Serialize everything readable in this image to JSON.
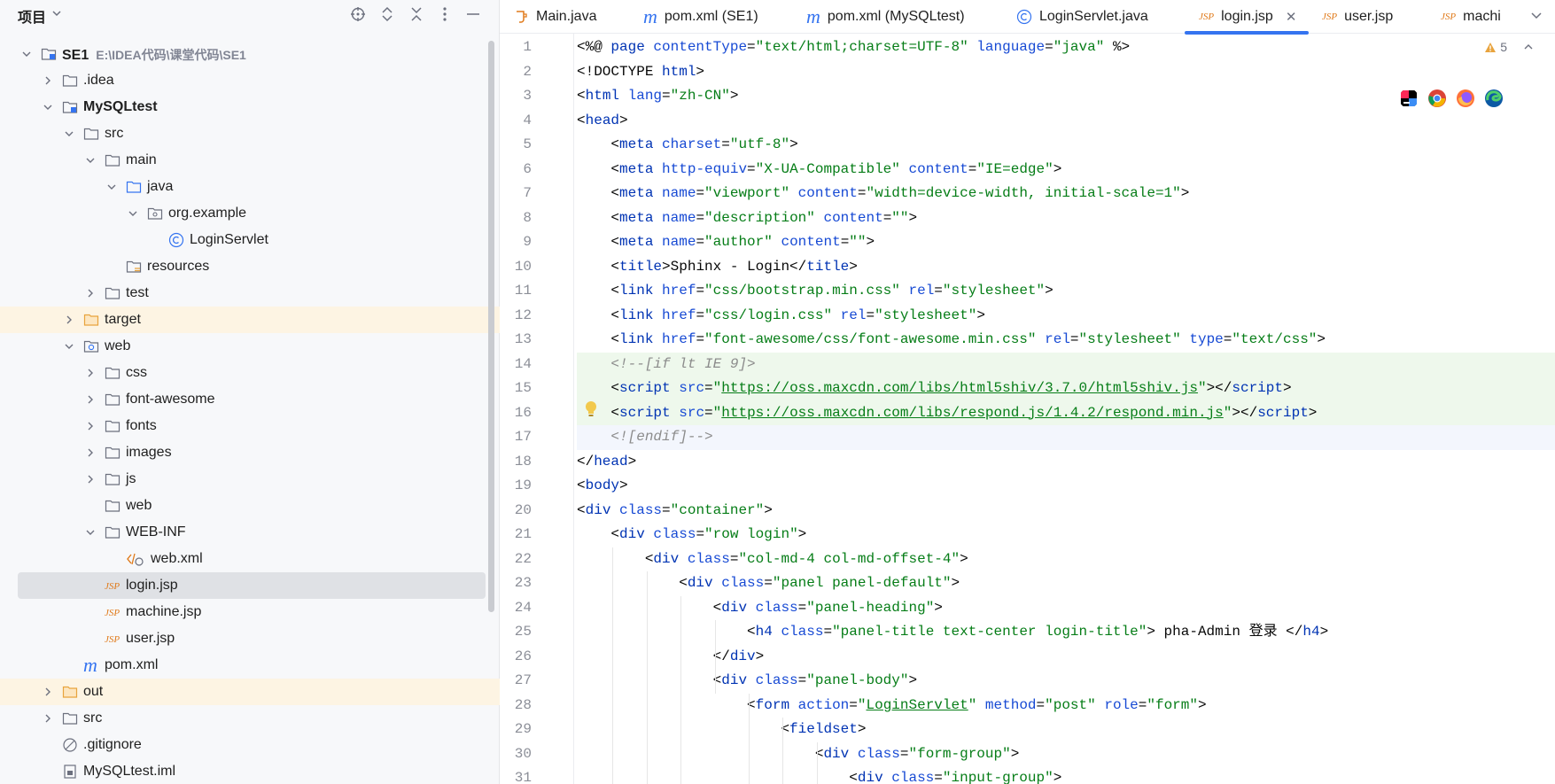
{
  "project_panel": {
    "title": "项目",
    "tree": [
      {
        "label": "SE1",
        "path": "E:\\IDEA代码\\课堂代码\\SE1",
        "depth": 0,
        "expanded": true,
        "icon": "module-folder-icon",
        "bold": true
      },
      {
        "label": ".idea",
        "depth": 1,
        "expanded": false,
        "icon": "folder-icon"
      },
      {
        "label": "MySQLtest",
        "depth": 1,
        "expanded": true,
        "icon": "module-folder-icon",
        "bold": true
      },
      {
        "label": "src",
        "depth": 2,
        "expanded": true,
        "icon": "folder-icon"
      },
      {
        "label": "main",
        "depth": 3,
        "expanded": true,
        "icon": "folder-icon"
      },
      {
        "label": "java",
        "depth": 4,
        "expanded": true,
        "icon": "source-folder-icon"
      },
      {
        "label": "org.example",
        "depth": 5,
        "expanded": true,
        "icon": "package-icon"
      },
      {
        "label": "LoginServlet",
        "depth": 6,
        "icon": "class-icon"
      },
      {
        "label": "resources",
        "depth": 4,
        "icon": "resources-folder-icon"
      },
      {
        "label": "test",
        "depth": 3,
        "expanded": false,
        "icon": "folder-icon"
      },
      {
        "label": "target",
        "depth": 2,
        "expanded": false,
        "icon": "excluded-folder-icon",
        "highlight": true
      },
      {
        "label": "web",
        "depth": 2,
        "expanded": true,
        "icon": "web-folder-icon"
      },
      {
        "label": "css",
        "depth": 3,
        "expanded": false,
        "icon": "folder-icon"
      },
      {
        "label": "font-awesome",
        "depth": 3,
        "expanded": false,
        "icon": "folder-icon"
      },
      {
        "label": "fonts",
        "depth": 3,
        "expanded": false,
        "icon": "folder-icon"
      },
      {
        "label": "images",
        "depth": 3,
        "expanded": false,
        "icon": "folder-icon"
      },
      {
        "label": "js",
        "depth": 3,
        "expanded": false,
        "icon": "folder-icon"
      },
      {
        "label": "web",
        "depth": 3,
        "icon": "folder-icon"
      },
      {
        "label": "WEB-INF",
        "depth": 3,
        "expanded": true,
        "icon": "folder-icon"
      },
      {
        "label": "web.xml",
        "depth": 4,
        "icon": "xml-file-icon"
      },
      {
        "label": "login.jsp",
        "depth": 3,
        "icon": "jsp-file-icon",
        "selected": true
      },
      {
        "label": "machine.jsp",
        "depth": 3,
        "icon": "jsp-file-icon"
      },
      {
        "label": "user.jsp",
        "depth": 3,
        "icon": "jsp-file-icon"
      },
      {
        "label": "pom.xml",
        "depth": 2,
        "icon": "maven-file-icon"
      },
      {
        "label": "out",
        "depth": 1,
        "expanded": false,
        "icon": "excluded-folder-icon",
        "highlight": true
      },
      {
        "label": "src",
        "depth": 1,
        "expanded": false,
        "icon": "folder-icon"
      },
      {
        "label": ".gitignore",
        "depth": 1,
        "icon": "ignore-file-icon"
      },
      {
        "label": "MySQLtest.iml",
        "depth": 1,
        "icon": "iml-file-icon"
      }
    ]
  },
  "tabs": [
    {
      "label": "Main.java",
      "icon": "java-file-icon"
    },
    {
      "label": "pom.xml (SE1)",
      "icon": "maven-file-icon"
    },
    {
      "label": "pom.xml (MySQLtest)",
      "icon": "maven-file-icon"
    },
    {
      "label": "LoginServlet.java",
      "icon": "class-icon"
    },
    {
      "label": "login.jsp",
      "icon": "jsp-file-icon",
      "active": true
    },
    {
      "label": "user.jsp",
      "icon": "jsp-file-icon"
    },
    {
      "label": "machi",
      "icon": "jsp-file-icon"
    }
  ],
  "editor": {
    "warning_count": "5",
    "jsp_glyph": "JSP",
    "lines": [
      [
        [
          "plain",
          "<%@ "
        ],
        [
          "tag",
          "page "
        ],
        [
          "attr",
          "contentType"
        ],
        [
          "plain",
          "="
        ],
        [
          "str",
          "\"text/html;charset=UTF-8\" "
        ],
        [
          "attr",
          "language"
        ],
        [
          "plain",
          "="
        ],
        [
          "str",
          "\"java\" "
        ],
        [
          "plain",
          "%>"
        ]
      ],
      [
        [
          "plain",
          "<!DOCTYPE "
        ],
        [
          "tag",
          "html"
        ],
        [
          "plain",
          ">"
        ]
      ],
      [
        [
          "plain",
          "<"
        ],
        [
          "tag",
          "html "
        ],
        [
          "attr",
          "lang"
        ],
        [
          "plain",
          "="
        ],
        [
          "str",
          "\"zh-CN\""
        ],
        [
          "plain",
          ">"
        ]
      ],
      [
        [
          "plain",
          "<"
        ],
        [
          "tag",
          "head"
        ],
        [
          "plain",
          ">"
        ]
      ],
      [
        [
          "plain",
          "    <"
        ],
        [
          "tag",
          "meta "
        ],
        [
          "attr",
          "charset"
        ],
        [
          "plain",
          "="
        ],
        [
          "str",
          "\"utf-8\""
        ],
        [
          "plain",
          ">"
        ]
      ],
      [
        [
          "plain",
          "    <"
        ],
        [
          "tag",
          "meta "
        ],
        [
          "attr",
          "http-equiv"
        ],
        [
          "plain",
          "="
        ],
        [
          "str",
          "\"X-UA-Compatible\" "
        ],
        [
          "attr",
          "content"
        ],
        [
          "plain",
          "="
        ],
        [
          "str",
          "\"IE=edge\""
        ],
        [
          "plain",
          ">"
        ]
      ],
      [
        [
          "plain",
          "    <"
        ],
        [
          "tag",
          "meta "
        ],
        [
          "attr",
          "name"
        ],
        [
          "plain",
          "="
        ],
        [
          "str",
          "\"viewport\" "
        ],
        [
          "attr",
          "content"
        ],
        [
          "plain",
          "="
        ],
        [
          "str",
          "\"width=device-width, initial-scale=1\""
        ],
        [
          "plain",
          ">"
        ]
      ],
      [
        [
          "plain",
          "    <"
        ],
        [
          "tag",
          "meta "
        ],
        [
          "attr",
          "name"
        ],
        [
          "plain",
          "="
        ],
        [
          "str",
          "\"description\" "
        ],
        [
          "attr",
          "content"
        ],
        [
          "plain",
          "="
        ],
        [
          "str",
          "\"\""
        ],
        [
          "plain",
          ">"
        ]
      ],
      [
        [
          "plain",
          "    <"
        ],
        [
          "tag",
          "meta "
        ],
        [
          "attr",
          "name"
        ],
        [
          "plain",
          "="
        ],
        [
          "str",
          "\"author\" "
        ],
        [
          "attr",
          "content"
        ],
        [
          "plain",
          "="
        ],
        [
          "str",
          "\"\""
        ],
        [
          "plain",
          ">"
        ]
      ],
      [
        [
          "plain",
          "    <"
        ],
        [
          "tag",
          "title"
        ],
        [
          "plain",
          ">Sphinx - Login</"
        ],
        [
          "tag",
          "title"
        ],
        [
          "plain",
          ">"
        ]
      ],
      [
        [
          "plain",
          "    <"
        ],
        [
          "tag",
          "link "
        ],
        [
          "attr",
          "href"
        ],
        [
          "plain",
          "="
        ],
        [
          "str",
          "\"css/bootstrap.min.css\" "
        ],
        [
          "attr",
          "rel"
        ],
        [
          "plain",
          "="
        ],
        [
          "str",
          "\"stylesheet\""
        ],
        [
          "plain",
          ">"
        ]
      ],
      [
        [
          "plain",
          "    <"
        ],
        [
          "tag",
          "link "
        ],
        [
          "attr",
          "href"
        ],
        [
          "plain",
          "="
        ],
        [
          "str",
          "\"css/login.css\" "
        ],
        [
          "attr",
          "rel"
        ],
        [
          "plain",
          "="
        ],
        [
          "str",
          "\"stylesheet\""
        ],
        [
          "plain",
          ">"
        ]
      ],
      [
        [
          "plain",
          "    <"
        ],
        [
          "tag",
          "link "
        ],
        [
          "attr",
          "href"
        ],
        [
          "plain",
          "="
        ],
        [
          "str",
          "\"font-awesome/css/font-awesome.min.css\" "
        ],
        [
          "attr",
          "rel"
        ],
        [
          "plain",
          "="
        ],
        [
          "str",
          "\"stylesheet\" "
        ],
        [
          "attr",
          "type"
        ],
        [
          "plain",
          "="
        ],
        [
          "str",
          "\"text/css\""
        ],
        [
          "plain",
          ">"
        ]
      ],
      [
        [
          "cmt",
          "    <!--[if lt IE 9]>"
        ]
      ],
      [
        [
          "plain",
          "    <"
        ],
        [
          "tag",
          "script "
        ],
        [
          "attr",
          "src"
        ],
        [
          "plain",
          "="
        ],
        [
          "str",
          "\""
        ],
        [
          "url",
          "https://oss.maxcdn.com/libs/html5shiv/3.7.0/html5shiv.js"
        ],
        [
          "str",
          "\""
        ],
        [
          "plain",
          "></"
        ],
        [
          "tag",
          "script"
        ],
        [
          "plain",
          ">"
        ]
      ],
      [
        [
          "plain",
          "    <"
        ],
        [
          "tag",
          "script "
        ],
        [
          "attr",
          "src"
        ],
        [
          "plain",
          "="
        ],
        [
          "str",
          "\""
        ],
        [
          "url",
          "https://oss.maxcdn.com/libs/respond.js/1.4.2/respond.min.js"
        ],
        [
          "str",
          "\""
        ],
        [
          "plain",
          "></"
        ],
        [
          "tag",
          "script"
        ],
        [
          "plain",
          ">"
        ]
      ],
      [
        [
          "cmt",
          "    <![endif]-->"
        ]
      ],
      [
        [
          "plain",
          "</"
        ],
        [
          "tag",
          "head"
        ],
        [
          "plain",
          ">"
        ]
      ],
      [
        [
          "plain",
          "<"
        ],
        [
          "tag",
          "body"
        ],
        [
          "plain",
          ">"
        ]
      ],
      [
        [
          "plain",
          "<"
        ],
        [
          "tag",
          "div "
        ],
        [
          "attr",
          "class"
        ],
        [
          "plain",
          "="
        ],
        [
          "str",
          "\"container\""
        ],
        [
          "plain",
          ">"
        ]
      ],
      [
        [
          "plain",
          "    <"
        ],
        [
          "tag",
          "div "
        ],
        [
          "attr",
          "class"
        ],
        [
          "plain",
          "="
        ],
        [
          "str",
          "\"row login\""
        ],
        [
          "plain",
          ">"
        ]
      ],
      [
        [
          "plain",
          "        <"
        ],
        [
          "tag",
          "div "
        ],
        [
          "attr",
          "class"
        ],
        [
          "plain",
          "="
        ],
        [
          "str",
          "\"col-md-4 col-md-offset-4\""
        ],
        [
          "plain",
          ">"
        ]
      ],
      [
        [
          "plain",
          "            <"
        ],
        [
          "tag",
          "div "
        ],
        [
          "attr",
          "class"
        ],
        [
          "plain",
          "="
        ],
        [
          "str",
          "\"panel panel-default\""
        ],
        [
          "plain",
          ">"
        ]
      ],
      [
        [
          "plain",
          "                <"
        ],
        [
          "tag",
          "div "
        ],
        [
          "attr",
          "class"
        ],
        [
          "plain",
          "="
        ],
        [
          "str",
          "\"panel-heading\""
        ],
        [
          "plain",
          ">"
        ]
      ],
      [
        [
          "plain",
          "                    <"
        ],
        [
          "tag",
          "h4 "
        ],
        [
          "attr",
          "class"
        ],
        [
          "plain",
          "="
        ],
        [
          "str",
          "\"panel-title text-center login-title\""
        ],
        [
          "plain",
          "> pha-Admin 登录 </"
        ],
        [
          "tag",
          "h4"
        ],
        [
          "plain",
          ">"
        ]
      ],
      [
        [
          "plain",
          "                </"
        ],
        [
          "tag",
          "div"
        ],
        [
          "plain",
          ">"
        ]
      ],
      [
        [
          "plain",
          "                <"
        ],
        [
          "tag",
          "div "
        ],
        [
          "attr",
          "class"
        ],
        [
          "plain",
          "="
        ],
        [
          "str",
          "\"panel-body\""
        ],
        [
          "plain",
          ">"
        ]
      ],
      [
        [
          "plain",
          "                    <"
        ],
        [
          "tag",
          "form "
        ],
        [
          "attr",
          "action"
        ],
        [
          "plain",
          "="
        ],
        [
          "str",
          "\""
        ],
        [
          "url",
          "LoginServlet"
        ],
        [
          "str",
          "\" "
        ],
        [
          "attr",
          "method"
        ],
        [
          "plain",
          "="
        ],
        [
          "str",
          "\"post\" "
        ],
        [
          "attr",
          "role"
        ],
        [
          "plain",
          "="
        ],
        [
          "str",
          "\"form\""
        ],
        [
          "plain",
          ">"
        ]
      ],
      [
        [
          "plain",
          "                        <"
        ],
        [
          "tag",
          "fieldset"
        ],
        [
          "plain",
          ">"
        ]
      ],
      [
        [
          "plain",
          "                            <"
        ],
        [
          "tag",
          "div "
        ],
        [
          "attr",
          "class"
        ],
        [
          "plain",
          "="
        ],
        [
          "str",
          "\"form-group\""
        ],
        [
          "plain",
          ">"
        ]
      ],
      [
        [
          "plain",
          "                                <"
        ],
        [
          "tag",
          "div "
        ],
        [
          "attr",
          "class"
        ],
        [
          "plain",
          "="
        ],
        [
          "str",
          "\"input-group\""
        ],
        [
          "plain",
          ">"
        ]
      ]
    ]
  }
}
